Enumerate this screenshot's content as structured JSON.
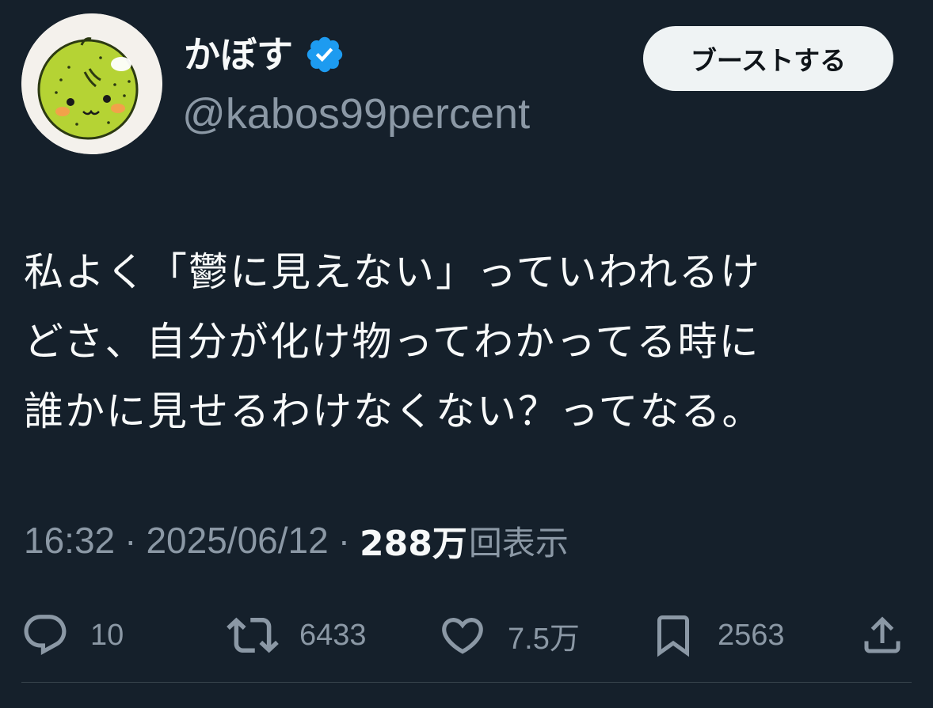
{
  "author": {
    "display_name": "かぼす",
    "handle": "@kabos99percent",
    "verified": true,
    "avatar_icon": "kabosu-character-avatar"
  },
  "header": {
    "boost_label": "ブーストする"
  },
  "tweet": {
    "lines": [
      "私よく「鬱に見えない」っていわれるけ",
      "どさ、自分が化け物ってわかってる時に",
      "誰かに見せるわけなくない？ってなる。"
    ]
  },
  "meta": {
    "time": "16:32",
    "separator": "·",
    "date": "2025/06/12",
    "views_count": "288万",
    "views_label": "回表示"
  },
  "actions": {
    "reply": {
      "icon": "reply-icon",
      "count": "10"
    },
    "repost": {
      "icon": "repost-icon",
      "count": "6433"
    },
    "like": {
      "icon": "heart-icon",
      "count": "7.5万"
    },
    "bookmark": {
      "icon": "bookmark-icon",
      "count": "2563"
    },
    "share": {
      "icon": "share-icon"
    }
  },
  "colors": {
    "background": "#15202b",
    "text_primary": "#f7f9f9",
    "text_secondary": "#8b98a5",
    "verified_blue": "#1d9bf0",
    "button_bg": "#eff3f4",
    "divider": "#38444d"
  }
}
